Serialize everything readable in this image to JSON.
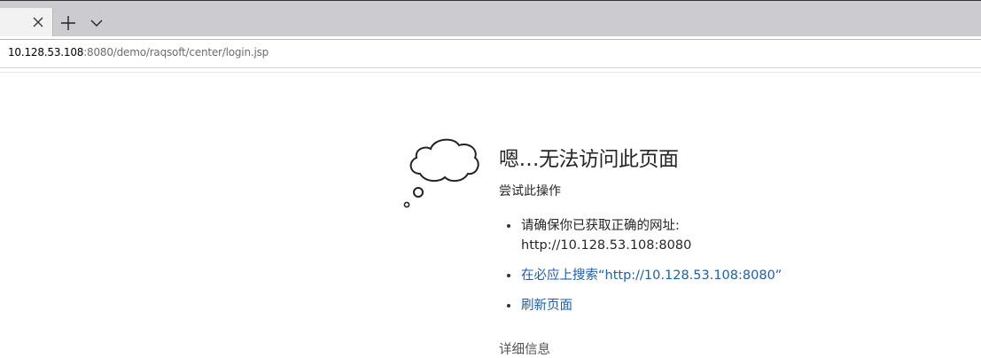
{
  "browser": {
    "tab_close_icon": "close-icon",
    "new_tab_icon": "plus-icon",
    "tab_list_icon": "chevron-down-icon",
    "address_bar": {
      "host": "10.128.53.108",
      "path": ":8080/demo/raqsoft/center/login.jsp"
    }
  },
  "error_page": {
    "illustration": "thought-cloud-icon",
    "title": "嗯…无法访问此页面",
    "subtitle": "尝试此操作",
    "suggestions": {
      "check_url_label": "请确保你已获取正确的网址:",
      "check_url_value": "http://10.128.53.108:8080",
      "search_link": "在必应上搜索“http://10.128.53.108:8080”",
      "refresh_link": "刷新页面"
    },
    "details_label": "详细信息"
  },
  "colors": {
    "tabbar": "#cccbd0",
    "active_tab": "#f2f2f2",
    "link": "#1e5fa8",
    "text": "#262626"
  }
}
